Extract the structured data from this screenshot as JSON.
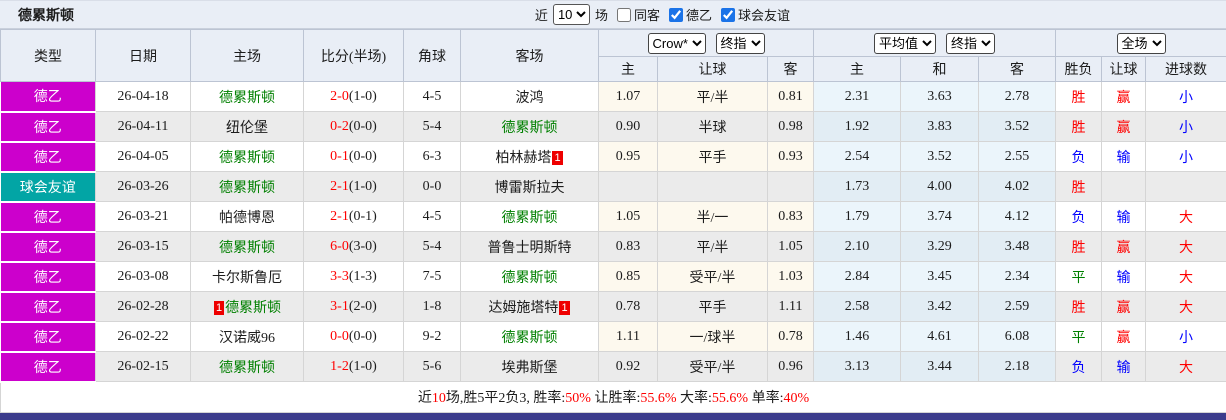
{
  "palette": {
    "red": "#FF0000",
    "blue": "#0000FF",
    "green": "#008000",
    "magenta": "#CC00CC",
    "teal": "#02A5A5",
    "header_bg": "#E9EEF6",
    "stripe_bg": "#EBEBEB",
    "handicap_bg": "#FDF9EE",
    "avg_bg": "#EBF5FB",
    "footer_bar": "#3C3C8C"
  },
  "header": {
    "team": "德累斯顿",
    "near_label": "近",
    "near_value": "10",
    "games_label": "场",
    "checkboxes": [
      {
        "label": "同客",
        "checked": false
      },
      {
        "label": "德乙",
        "checked": true
      },
      {
        "label": "球会友谊",
        "checked": true
      }
    ]
  },
  "selects": {
    "odds_source": "Crow*",
    "final1": "终指",
    "average": "平均值",
    "final2": "终指",
    "fulltime": "全场"
  },
  "columns": {
    "type": "类型",
    "date": "日期",
    "home": "主场",
    "score": "比分(半场)",
    "corner": "角球",
    "away": "客场",
    "sub": [
      "主",
      "让球",
      "客",
      "主",
      "和",
      "客",
      "胜负",
      "让球",
      "进球数"
    ]
  },
  "rows": [
    {
      "league": "德乙",
      "league_color": "magenta",
      "date": "26-04-18",
      "home": "德累斯顿",
      "home_green": true,
      "home_card": "",
      "score": "2-0",
      "half": "(1-0)",
      "corner": "4-5",
      "away": "波鸿",
      "away_green": false,
      "away_card": "",
      "odds": [
        "1.07",
        "平/半",
        "0.81"
      ],
      "avg": [
        "2.31",
        "3.63",
        "2.78"
      ],
      "result": "胜",
      "result_color": "red",
      "let": "赢",
      "let_color": "red",
      "goal": "小",
      "goal_color": "blue"
    },
    {
      "league": "德乙",
      "league_color": "magenta",
      "date": "26-04-11",
      "home": "纽伦堡",
      "home_green": false,
      "home_card": "",
      "score": "0-2",
      "half": "(0-0)",
      "corner": "5-4",
      "away": "德累斯顿",
      "away_green": true,
      "away_card": "",
      "odds": [
        "0.90",
        "半球",
        "0.98"
      ],
      "avg": [
        "1.92",
        "3.83",
        "3.52"
      ],
      "result": "胜",
      "result_color": "red",
      "let": "赢",
      "let_color": "red",
      "goal": "小",
      "goal_color": "blue"
    },
    {
      "league": "德乙",
      "league_color": "magenta",
      "date": "26-04-05",
      "home": "德累斯顿",
      "home_green": true,
      "home_card": "",
      "score": "0-1",
      "half": "(0-0)",
      "corner": "6-3",
      "away": "柏林赫塔",
      "away_green": false,
      "away_card": "1",
      "odds": [
        "0.95",
        "平手",
        "0.93"
      ],
      "avg": [
        "2.54",
        "3.52",
        "2.55"
      ],
      "result": "负",
      "result_color": "blue",
      "let": "输",
      "let_color": "blue",
      "goal": "小",
      "goal_color": "blue"
    },
    {
      "league": "球会友谊",
      "league_color": "teal",
      "date": "26-03-26",
      "home": "德累斯顿",
      "home_green": true,
      "home_card": "",
      "score": "2-1",
      "half": "(1-0)",
      "corner": "0-0",
      "away": "博雷斯拉夫",
      "away_green": false,
      "away_card": "",
      "odds": [
        "",
        "",
        ""
      ],
      "avg": [
        "1.73",
        "4.00",
        "4.02"
      ],
      "result": "胜",
      "result_color": "red",
      "let": "",
      "let_color": "",
      "goal": "",
      "goal_color": ""
    },
    {
      "league": "德乙",
      "league_color": "magenta",
      "date": "26-03-21",
      "home": "帕德博恩",
      "home_green": false,
      "home_card": "",
      "score": "2-1",
      "half": "(0-1)",
      "corner": "4-5",
      "away": "德累斯顿",
      "away_green": true,
      "away_card": "",
      "odds": [
        "1.05",
        "半/一",
        "0.83"
      ],
      "avg": [
        "1.79",
        "3.74",
        "4.12"
      ],
      "result": "负",
      "result_color": "blue",
      "let": "输",
      "let_color": "blue",
      "goal": "大",
      "goal_color": "red"
    },
    {
      "league": "德乙",
      "league_color": "magenta",
      "date": "26-03-15",
      "home": "德累斯顿",
      "home_green": true,
      "home_card": "",
      "score": "6-0",
      "half": "(3-0)",
      "corner": "5-4",
      "away": "普鲁士明斯特",
      "away_green": false,
      "away_card": "",
      "odds": [
        "0.83",
        "平/半",
        "1.05"
      ],
      "avg": [
        "2.10",
        "3.29",
        "3.48"
      ],
      "result": "胜",
      "result_color": "red",
      "let": "赢",
      "let_color": "red",
      "goal": "大",
      "goal_color": "red"
    },
    {
      "league": "德乙",
      "league_color": "magenta",
      "date": "26-03-08",
      "home": "卡尔斯鲁厄",
      "home_green": false,
      "home_card": "",
      "score": "3-3",
      "half": "(1-3)",
      "corner": "7-5",
      "away": "德累斯顿",
      "away_green": true,
      "away_card": "",
      "odds": [
        "0.85",
        "受平/半",
        "1.03"
      ],
      "avg": [
        "2.84",
        "3.45",
        "2.34"
      ],
      "result": "平",
      "result_color": "green",
      "let": "输",
      "let_color": "blue",
      "goal": "大",
      "goal_color": "red"
    },
    {
      "league": "德乙",
      "league_color": "magenta",
      "date": "26-02-28",
      "home": "德累斯顿",
      "home_green": true,
      "home_card": "1",
      "score": "3-1",
      "half": "(2-0)",
      "corner": "1-8",
      "away": "达姆施塔特",
      "away_green": false,
      "away_card": "1",
      "odds": [
        "0.78",
        "平手",
        "1.11"
      ],
      "avg": [
        "2.58",
        "3.42",
        "2.59"
      ],
      "result": "胜",
      "result_color": "red",
      "let": "赢",
      "let_color": "red",
      "goal": "大",
      "goal_color": "red"
    },
    {
      "league": "德乙",
      "league_color": "magenta",
      "date": "26-02-22",
      "home": "汉诺威96",
      "home_green": false,
      "home_card": "",
      "score": "0-0",
      "half": "(0-0)",
      "corner": "9-2",
      "away": "德累斯顿",
      "away_green": true,
      "away_card": "",
      "odds": [
        "1.11",
        "一/球半",
        "0.78"
      ],
      "avg": [
        "1.46",
        "4.61",
        "6.08"
      ],
      "result": "平",
      "result_color": "green",
      "let": "赢",
      "let_color": "red",
      "goal": "小",
      "goal_color": "blue"
    },
    {
      "league": "德乙",
      "league_color": "magenta",
      "date": "26-02-15",
      "home": "德累斯顿",
      "home_green": true,
      "home_card": "",
      "score": "1-2",
      "half": "(1-0)",
      "corner": "5-6",
      "away": "埃弗斯堡",
      "away_green": false,
      "away_card": "",
      "odds": [
        "0.92",
        "受平/半",
        "0.96"
      ],
      "avg": [
        "3.13",
        "3.44",
        "2.18"
      ],
      "result": "负",
      "result_color": "blue",
      "let": "输",
      "let_color": "blue",
      "goal": "大",
      "goal_color": "red"
    }
  ],
  "summary_parts": [
    {
      "t": "近",
      "red": false
    },
    {
      "t": "10",
      "red": true
    },
    {
      "t": "场,胜5平2负3, 胜率:",
      "red": false
    },
    {
      "t": "50%",
      "red": true
    },
    {
      "t": " 让胜率:",
      "red": false
    },
    {
      "t": "55.6%",
      "red": true
    },
    {
      "t": " 大率:",
      "red": false
    },
    {
      "t": "55.6%",
      "red": true
    },
    {
      "t": " 单率:",
      "red": false
    },
    {
      "t": "40%",
      "red": true
    }
  ]
}
